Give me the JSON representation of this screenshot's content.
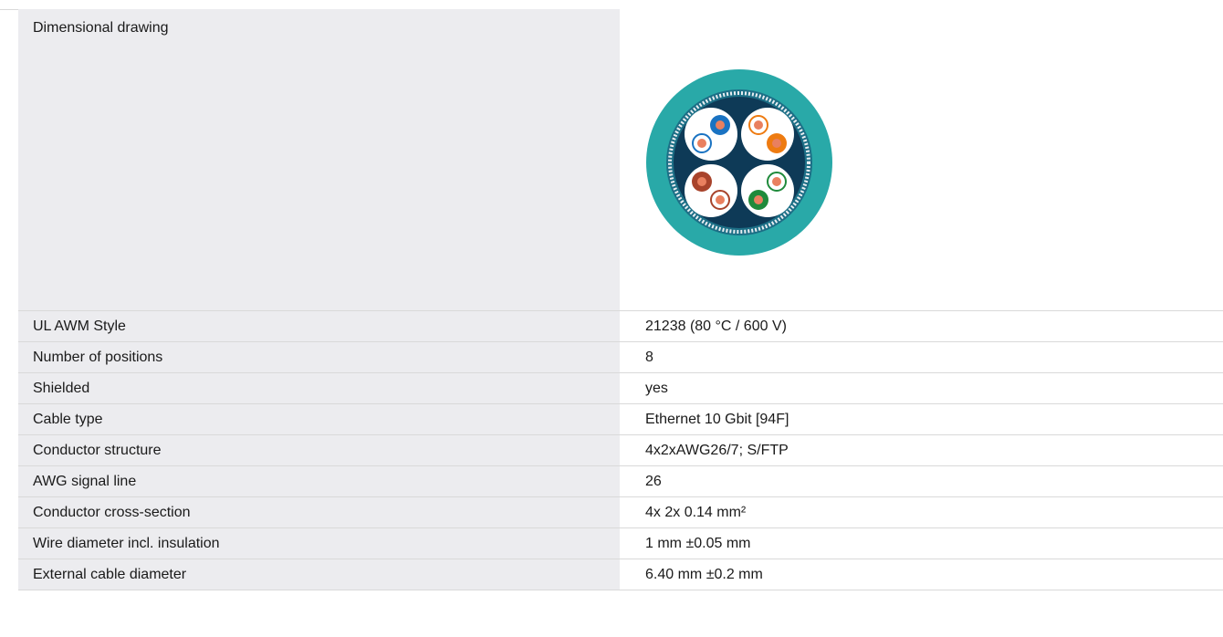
{
  "drawing": {
    "label": "Dimensional drawing",
    "image_name": "cable-cross-section",
    "colors": {
      "jacket": "#29a9a8",
      "shield": "#0e3a57",
      "pair_foil": "#ffffff",
      "copper": "#e9805f",
      "blue": "#1a73c2",
      "orange": "#ee7b11",
      "brown": "#a8432b",
      "green": "#1f8a3b"
    }
  },
  "specs": [
    {
      "label": "UL AWM Style",
      "value": "21238 (80 °C / 600 V)"
    },
    {
      "label": "Number of positions",
      "value": "8"
    },
    {
      "label": "Shielded",
      "value": "yes"
    },
    {
      "label": "Cable type",
      "value": "Ethernet 10 Gbit [94F]"
    },
    {
      "label": "Conductor structure",
      "value": "4x2xAWG26/7; S/FTP"
    },
    {
      "label": "AWG signal line",
      "value": "26"
    },
    {
      "label": "Conductor cross-section",
      "value": "4x 2x 0.14 mm²"
    },
    {
      "label": "Wire diameter incl. insulation",
      "value": "1 mm ±0.05 mm"
    },
    {
      "label": "External cable diameter",
      "value": "6.40 mm ±0.2 mm"
    }
  ]
}
